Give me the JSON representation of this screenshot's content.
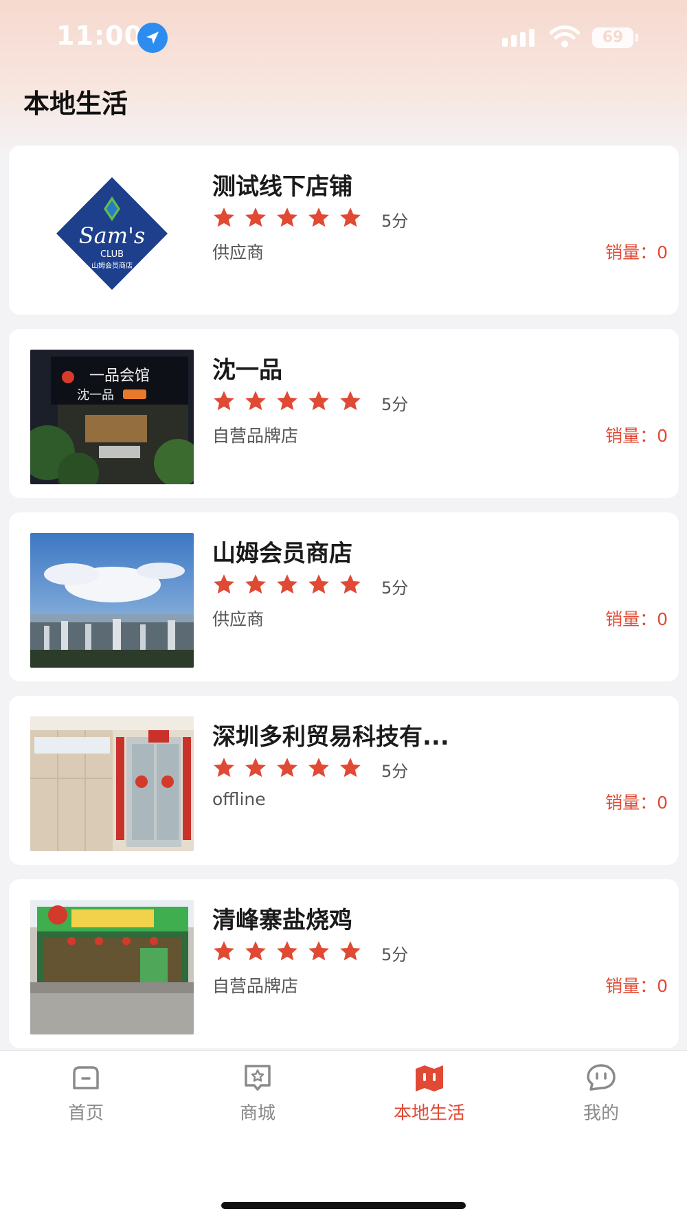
{
  "status_bar": {
    "time": "11:00",
    "battery": "69",
    "icons": [
      "location-arrow-icon",
      "cellular-signal-icon",
      "wifi-icon",
      "battery-icon"
    ]
  },
  "page": {
    "title": "本地生活"
  },
  "colors": {
    "accent": "#e04a35",
    "star": "#e04a35",
    "inactive": "#8a8a8a"
  },
  "stores": [
    {
      "name": "测试线下店铺",
      "score": "5分",
      "rating": 5,
      "category": "供应商",
      "sales": "销量：0",
      "image": "sams-club-logo"
    },
    {
      "name": "沈一品",
      "score": "5分",
      "rating": 5,
      "category": "自营品牌店",
      "sales": "销量：0",
      "image": "night-storefront-photo"
    },
    {
      "name": "山姆会员商店",
      "score": "5分",
      "rating": 5,
      "category": "供应商",
      "sales": "销量：0",
      "image": "city-skyline-photo"
    },
    {
      "name": "深圳多利贸易科技有...",
      "score": "5分",
      "rating": 5,
      "category": "offline",
      "sales": "销量：0",
      "image": "office-entrance-photo"
    },
    {
      "name": "清峰寨盐烧鸡",
      "score": "5分",
      "rating": 5,
      "category": "自营品牌店",
      "sales": "销量：0",
      "image": "restaurant-front-photo"
    }
  ],
  "tabbar": {
    "tabs": [
      {
        "label": "首页",
        "icon": "home-icon",
        "active": false
      },
      {
        "label": "商城",
        "icon": "mall-icon",
        "active": false
      },
      {
        "label": "本地生活",
        "icon": "local-life-map-icon",
        "active": true
      },
      {
        "label": "我的",
        "icon": "profile-chat-icon",
        "active": false
      }
    ]
  }
}
